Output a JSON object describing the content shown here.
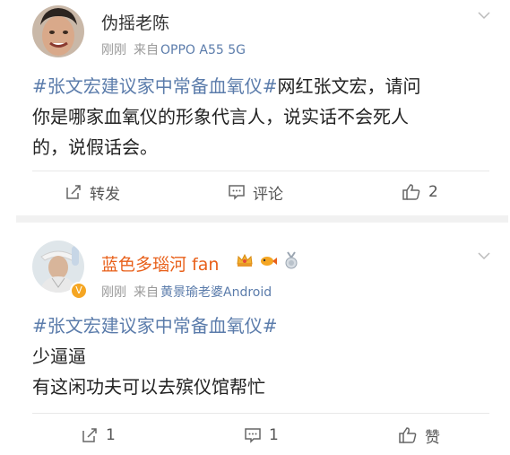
{
  "posts": [
    {
      "username": "伪摇老陈",
      "time": "刚刚",
      "source_prefix": "来自",
      "source": "OPPO A55 5G",
      "topic": "#张文宏建议家中常备血氧仪#",
      "lines": [
        "网红张文宏，请问",
        "你是哪家血氧仪的形象代言人，说实话不会死人",
        "的，说假话会。"
      ],
      "actions": {
        "repost": "转发",
        "comment": "评论",
        "like": "2"
      }
    },
    {
      "username": "蓝色多瑙河 fan",
      "time": "刚刚",
      "source_prefix": "来自",
      "source": "黄景瑜老婆Android",
      "topic": "#张文宏建议家中常备血氧仪#",
      "lines": [
        "少逼逼",
        "有这闲功夫可以去殡仪馆帮忙"
      ],
      "actions": {
        "repost": "1",
        "comment": "1",
        "like": "赞"
      },
      "badges": [
        "crown-badge-icon",
        "fish-badge-icon",
        "medal-badge-icon"
      ],
      "verified_mark": "V"
    }
  ],
  "colors": {
    "link": "#5b7cab",
    "vip_name": "#e8601a",
    "meta": "#999999"
  }
}
